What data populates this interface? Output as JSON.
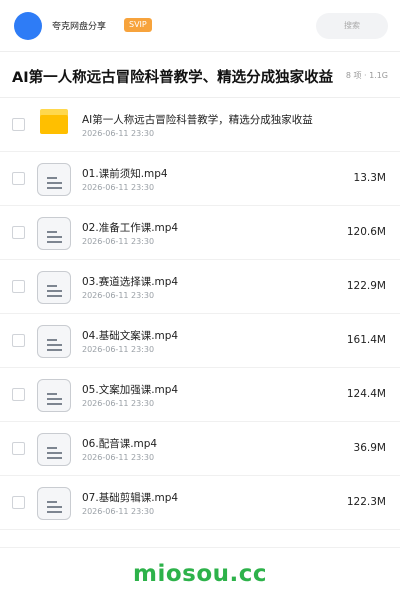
{
  "header": {
    "share_name": "夸克网盘分享",
    "badge": "SVIP",
    "search_placeholder": "搜索"
  },
  "title": "AI第一人称远古冒险科普教学、精选分成独家收益",
  "meta": "8 项 · 1.1G",
  "items": [
    {
      "type": "folder",
      "name": "AI第一人称远古冒险科普教学，精选分成独家收益",
      "date": "2026-06-11 23:30",
      "size": ""
    },
    {
      "type": "file",
      "name": "01.课前须知.mp4",
      "date": "2026-06-11 23:30",
      "size": "13.3M"
    },
    {
      "type": "file",
      "name": "02.准备工作课.mp4",
      "date": "2026-06-11 23:30",
      "size": "120.6M"
    },
    {
      "type": "file",
      "name": "03.赛道选择课.mp4",
      "date": "2026-06-11 23:30",
      "size": "122.9M"
    },
    {
      "type": "file",
      "name": "04.基础文案课.mp4",
      "date": "2026-06-11 23:30",
      "size": "161.4M"
    },
    {
      "type": "file",
      "name": "05.文案加强课.mp4",
      "date": "2026-06-11 23:30",
      "size": "124.4M"
    },
    {
      "type": "file",
      "name": "06.配音课.mp4",
      "date": "2026-06-11 23:30",
      "size": "36.9M"
    },
    {
      "type": "file",
      "name": "07.基础剪辑课.mp4",
      "date": "2026-06-11 23:30",
      "size": "122.3M"
    }
  ],
  "footer": {
    "watermark": "miosou.cc"
  },
  "colors": {
    "avatar": "#2e7cf6",
    "badge": "#f7a33c",
    "folder": "#ffbf00",
    "watermark": "#2db24a"
  }
}
